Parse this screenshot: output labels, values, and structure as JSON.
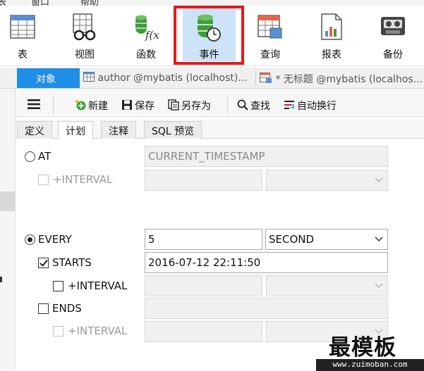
{
  "menubar": {
    "items": [
      "表",
      "窗口",
      "帮助"
    ]
  },
  "ribbon": {
    "buttons": [
      {
        "label": "表",
        "icon": "table-icon"
      },
      {
        "label": "视图",
        "icon": "view-icon"
      },
      {
        "label": "函数",
        "icon": "function-icon"
      },
      {
        "label": "事件",
        "icon": "event-icon",
        "selected": true
      },
      {
        "label": "查询",
        "icon": "query-icon"
      },
      {
        "label": "报表",
        "icon": "report-icon"
      },
      {
        "label": "备份",
        "icon": "backup-icon"
      }
    ],
    "function_glyph": "f(x)"
  },
  "tabs": {
    "object": "对象",
    "docs": [
      "author @mybatis (localhost)...",
      "* 无标题 @mybatis (localhos..."
    ]
  },
  "toolbar": {
    "new": "新建",
    "save": "保存",
    "save_as": "另存为",
    "find": "查找",
    "wrap": "自动换行"
  },
  "subtabs": [
    "定义",
    "计划",
    "注释",
    "SQL 预览"
  ],
  "subtabs_active": "计划",
  "form": {
    "at_label": "AT",
    "at_value": "CURRENT_TIMESTAMP",
    "at_selected": false,
    "at_interval_label": "+INTERVAL",
    "every_label": "EVERY",
    "every_selected": true,
    "every_value": "5",
    "every_unit": "SECOND",
    "starts_label": "STARTS",
    "starts_checked": true,
    "starts_value": "2016-07-12 22:11:50",
    "starts_interval_label": "+INTERVAL",
    "ends_label": "ENDS",
    "ends_checked": false,
    "ends_interval_label": "+INTERVAL"
  },
  "watermark": {
    "title": "最模板",
    "url": "www.zuimoban.com"
  },
  "colors": {
    "accent": "#1f8ee6",
    "highlight_border": "#e5191c",
    "selected_bg": "#cde3f7",
    "db_green": "#3f9a3a"
  }
}
